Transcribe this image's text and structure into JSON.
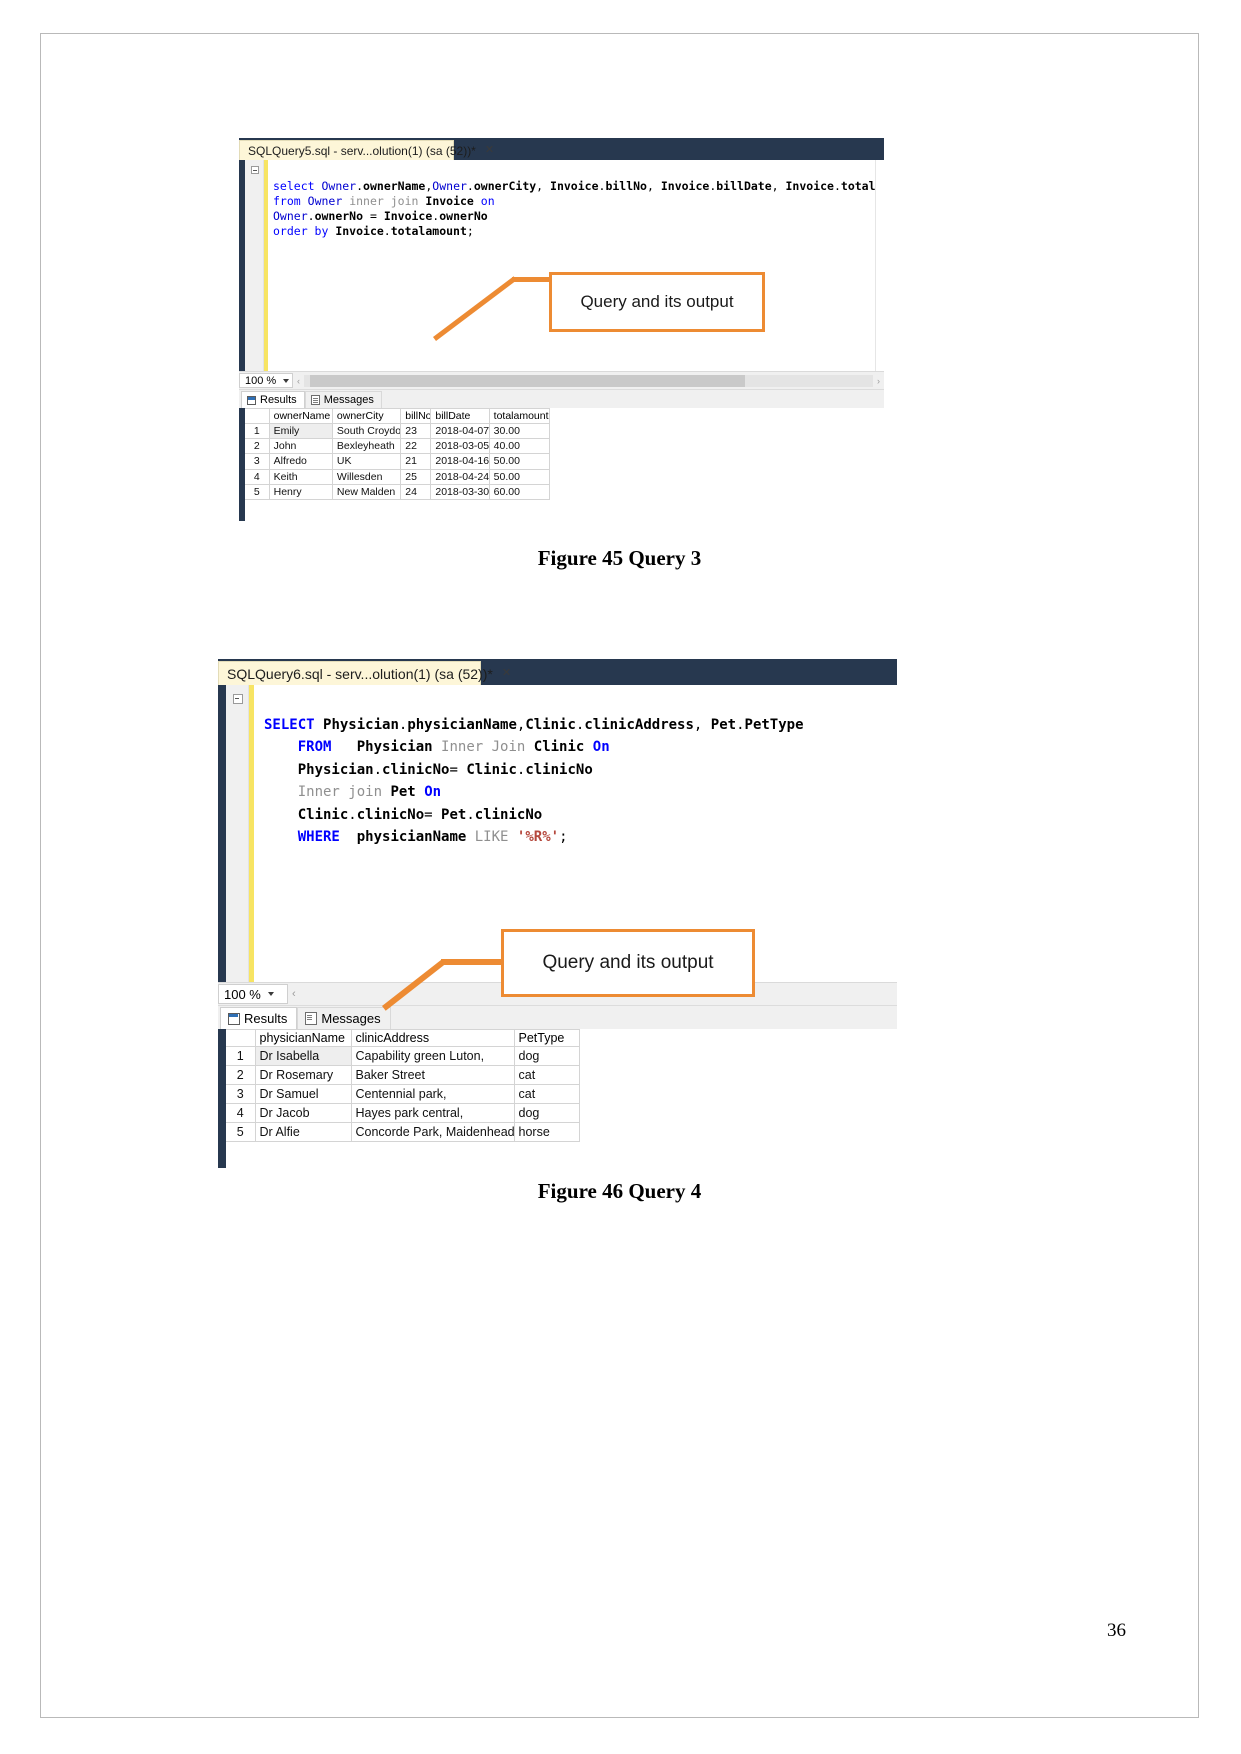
{
  "page": {
    "number": "36"
  },
  "figure45": {
    "caption": "Figure 45 Query 3",
    "window": {
      "tab_title": "SQLQuery5.sql - serv...olution(1) (sa (52))*",
      "tab_close": "✕"
    },
    "code_lines": [
      "select Owner.ownerName,Owner.ownerCity, Invoice.billNo, Invoice.billDate, Invoice.totalamount",
      "from Owner inner join Invoice on",
      "Owner.ownerNo = Invoice.ownerNo",
      "order by Invoice.totalamount;"
    ],
    "zoom": {
      "level": "100 %",
      "chevron": "‹",
      "right_chevron": "›"
    },
    "result_tabs": [
      {
        "label": "Results",
        "icon": "grid-icon",
        "active": true
      },
      {
        "label": "Messages",
        "icon": "messages-icon",
        "active": false
      }
    ],
    "grid": {
      "columns": [
        "",
        "ownerName",
        "ownerCity",
        "billNo",
        "billDate",
        "totalamount"
      ],
      "rows": [
        [
          "1",
          "Emily",
          "South Croydon",
          "23",
          "2018-04-07",
          "30.00"
        ],
        [
          "2",
          "John",
          "Bexleyheath",
          "22",
          "2018-03-05",
          "40.00"
        ],
        [
          "3",
          "Alfredo",
          "UK",
          "21",
          "2018-04-16",
          "50.00"
        ],
        [
          "4",
          "Keith",
          "Willesden",
          "25",
          "2018-04-24",
          "50.00"
        ],
        [
          "5",
          "Henry",
          "New Malden",
          "24",
          "2018-03-30",
          "60.00"
        ]
      ]
    },
    "callout": {
      "text": "Query and its output"
    }
  },
  "figure46": {
    "caption": "Figure 46 Query 4",
    "window": {
      "tab_title": "SQLQuery6.sql - serv...olution(1) (sa (52))*",
      "tab_close": "✕"
    },
    "code_lines": [
      "SELECT Physician.physicianName,Clinic.clinicAddress, Pet.PetType",
      "    FROM   Physician Inner Join Clinic On",
      "    Physician.clinicNo= Clinic.clinicNo",
      "    Inner join Pet On",
      "    Clinic.clinicNo= Pet.clinicNo",
      "    WHERE  physicianName LIKE '%R%';"
    ],
    "zoom": {
      "level": "100 %",
      "chevron": "‹"
    },
    "result_tabs": [
      {
        "label": "Results",
        "icon": "grid-icon",
        "active": true
      },
      {
        "label": "Messages",
        "icon": "messages-icon",
        "active": false
      }
    ],
    "grid": {
      "columns": [
        "",
        "physicianName",
        "clinicAddress",
        "PetType"
      ],
      "rows": [
        [
          "1",
          "Dr Isabella",
          "Capability green Luton,",
          "dog"
        ],
        [
          "2",
          "Dr Rosemary",
          "Baker Street",
          "cat"
        ],
        [
          "3",
          "Dr Samuel",
          "Centennial park,",
          "cat"
        ],
        [
          "4",
          "Dr Jacob",
          "Hayes park central,",
          "dog"
        ],
        [
          "5",
          "Dr Alfie",
          "Concorde Park, Maidenhead,",
          "horse"
        ]
      ]
    },
    "callout": {
      "text": "Query and its output"
    }
  },
  "colors": {
    "accent_orange": "#ed8b33",
    "titlebar_navy": "#27384f",
    "tab_cream": "#fdf6d8",
    "keyword_blue": "#0000ff",
    "string_red": "#b5483d"
  }
}
